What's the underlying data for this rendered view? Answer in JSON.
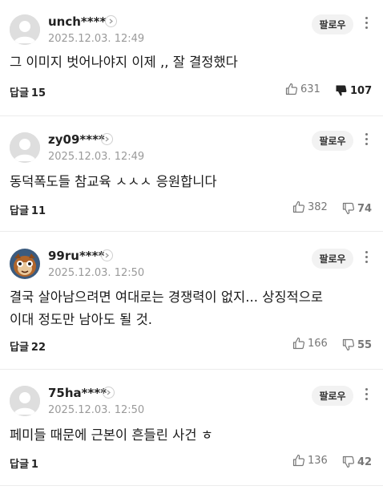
{
  "follow_label": "팔로우",
  "reply_label": "답글",
  "comments": [
    {
      "username": "unch****",
      "time": "2025.12.03. 12:49",
      "text": "그 이미지 벗어나야지 이제 ,, 잘 결정했다",
      "replies": "15",
      "likes": "631",
      "dislikes": "107"
    },
    {
      "username": "zy09****",
      "time": "2025.12.03. 12:49",
      "text": "동덕폭도들 참교육 ㅅㅅㅅ 응원합니다",
      "replies": "11",
      "likes": "382",
      "dislikes": "74"
    },
    {
      "username": "99ru****",
      "time": "2025.12.03. 12:50",
      "text_line1": "결국 살아남으려면 여대로는 경쟁력이 없지... 상징적으로",
      "text_line2": "이대 정도만 남아도 될 것.",
      "replies": "22",
      "likes": "166",
      "dislikes": "55"
    },
    {
      "username": "75ha****",
      "time": "2025.12.03. 12:50",
      "text": "페미들 때문에 근본이 흔들린 사건 ㅎ",
      "replies": "1",
      "likes": "136",
      "dislikes": "42"
    }
  ]
}
